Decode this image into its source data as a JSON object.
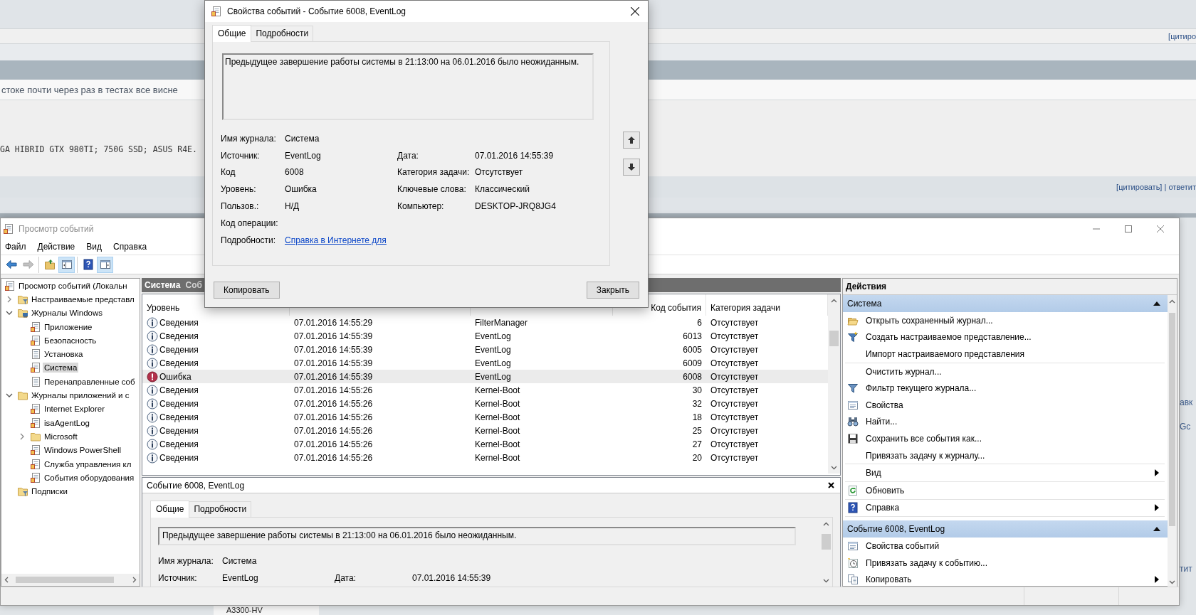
{
  "background_page": {
    "quote_link_top": "[цитиро",
    "post_text": "стоке почти через раз в тестах все висне",
    "signature": "GA HIBRID GTX 980TI; 750G SSD; ASUS R4E.",
    "quote_links": "[цитировать] | ответит",
    "side_fragments": [
      "авк",
      "Gc",
      "тит"
    ],
    "bottom_label": "A3300-HV"
  },
  "event_viewer": {
    "title": "Просмотр событий",
    "menu": [
      "Файл",
      "Действие",
      "Вид",
      "Справка"
    ],
    "toolbar": [
      [
        {
          "kind": "back",
          "pressed": false,
          "disabled": false
        },
        {
          "kind": "forward",
          "pressed": false,
          "disabled": true
        }
      ],
      [
        {
          "kind": "folder-up",
          "pressed": false,
          "disabled": false
        },
        {
          "kind": "panel",
          "pressed": true,
          "disabled": false
        }
      ],
      [
        {
          "kind": "help",
          "pressed": false,
          "disabled": false
        },
        {
          "kind": "panel-right",
          "pressed": true,
          "disabled": false
        }
      ]
    ],
    "tree": [
      {
        "label": "Просмотр событий (Локальн",
        "kind": "log",
        "selected": false,
        "children": [
          {
            "label": "Настраиваемые представл",
            "kind": "folder-filter",
            "selected": false,
            "expanded": false
          },
          {
            "label": "Журналы Windows",
            "kind": "folder-pc",
            "selected": false,
            "expanded": true,
            "children": [
              {
                "label": "Приложение",
                "kind": "log",
                "selected": false
              },
              {
                "label": "Безопасность",
                "kind": "log",
                "selected": false
              },
              {
                "label": "Установка",
                "kind": "doc",
                "selected": false
              },
              {
                "label": "Система",
                "kind": "log",
                "selected": true
              },
              {
                "label": "Перенаправленные соб",
                "kind": "doc",
                "selected": false
              }
            ]
          },
          {
            "label": "Журналы приложений и с",
            "kind": "folder",
            "selected": false,
            "expanded": true,
            "children": [
              {
                "label": "Internet Explorer",
                "kind": "log",
                "selected": false
              },
              {
                "label": "isaAgentLog",
                "kind": "log",
                "selected": false
              },
              {
                "label": "Microsoft",
                "kind": "folder",
                "selected": false,
                "expanded": false
              },
              {
                "label": "Windows PowerShell",
                "kind": "log",
                "selected": false
              },
              {
                "label": "Служба управления кл",
                "kind": "log",
                "selected": false
              },
              {
                "label": "События оборудования",
                "kind": "log",
                "selected": false
              }
            ]
          },
          {
            "label": "Подписки",
            "kind": "folder-filter",
            "selected": false
          }
        ]
      }
    ],
    "events": {
      "header": "Система",
      "header_fragment": "Соб",
      "columns": [
        "Уровень",
        "Код события",
        "Категория задачи"
      ],
      "rows": [
        {
          "kind": "info",
          "level": "Сведения",
          "date": "07.01.2016 14:55:29",
          "source": "FilterManager",
          "code": "6",
          "category": "Отсутствует",
          "selected": false
        },
        {
          "kind": "info",
          "level": "Сведения",
          "date": "07.01.2016 14:55:39",
          "source": "EventLog",
          "code": "6013",
          "category": "Отсутствует",
          "selected": false
        },
        {
          "kind": "info",
          "level": "Сведения",
          "date": "07.01.2016 14:55:39",
          "source": "EventLog",
          "code": "6005",
          "category": "Отсутствует",
          "selected": false
        },
        {
          "kind": "info",
          "level": "Сведения",
          "date": "07.01.2016 14:55:39",
          "source": "EventLog",
          "code": "6009",
          "category": "Отсутствует",
          "selected": false
        },
        {
          "kind": "error",
          "level": "Ошибка",
          "date": "07.01.2016 14:55:39",
          "source": "EventLog",
          "code": "6008",
          "category": "Отсутствует",
          "selected": true
        },
        {
          "kind": "info",
          "level": "Сведения",
          "date": "07.01.2016 14:55:26",
          "source": "Kernel-Boot",
          "code": "30",
          "category": "Отсутствует",
          "selected": false
        },
        {
          "kind": "info",
          "level": "Сведения",
          "date": "07.01.2016 14:55:26",
          "source": "Kernel-Boot",
          "code": "32",
          "category": "Отсутствует",
          "selected": false
        },
        {
          "kind": "info",
          "level": "Сведения",
          "date": "07.01.2016 14:55:26",
          "source": "Kernel-Boot",
          "code": "18",
          "category": "Отсутствует",
          "selected": false
        },
        {
          "kind": "info",
          "level": "Сведения",
          "date": "07.01.2016 14:55:26",
          "source": "Kernel-Boot",
          "code": "25",
          "category": "Отсутствует",
          "selected": false
        },
        {
          "kind": "info",
          "level": "Сведения",
          "date": "07.01.2016 14:55:26",
          "source": "Kernel-Boot",
          "code": "27",
          "category": "Отсутствует",
          "selected": false
        },
        {
          "kind": "info",
          "level": "Сведения",
          "date": "07.01.2016 14:55:26",
          "source": "Kernel-Boot",
          "code": "20",
          "category": "Отсутствует",
          "selected": false
        }
      ]
    },
    "detail": {
      "title": "Событие 6008, EventLog",
      "tabs": [
        {
          "label": "Общие",
          "selected": true
        },
        {
          "label": "Подробности",
          "selected": false
        }
      ],
      "description": "Предыдущее завершение работы системы в 21:13:00 на 06.01.2016 было неожиданным.",
      "fields": [
        {
          "label": "Имя журнала:",
          "value": "Система"
        },
        {
          "label": "Источник:",
          "value": "EventLog"
        }
      ],
      "fields_right": [
        {
          "label": "Дата:",
          "value": "07.01.2016 14:55:39"
        }
      ]
    },
    "actions": {
      "title": "Действия",
      "sections": [
        {
          "title": "Система",
          "expanded": true,
          "groups": [
            [
              {
                "label": "Открыть сохраненный журнал...",
                "kind": "folder-open",
                "submenu": false
              },
              {
                "label": "Создать настраиваемое представление...",
                "kind": "funnel-new",
                "submenu": false
              },
              {
                "label": "Импорт настраиваемого представления",
                "kind": "plain",
                "submenu": false
              }
            ],
            [
              {
                "label": "Очистить журнал...",
                "kind": "plain",
                "submenu": false
              },
              {
                "label": "Фильтр текущего журнала...",
                "kind": "funnel",
                "submenu": false
              },
              {
                "label": "Свойства",
                "kind": "window",
                "submenu": false
              },
              {
                "label": "Найти...",
                "kind": "binoculars",
                "submenu": false
              },
              {
                "label": "Сохранить все события как...",
                "kind": "save",
                "submenu": false
              },
              {
                "label": "Привязать задачу к журналу...",
                "kind": "plain",
                "submenu": false
              }
            ],
            [
              {
                "label": "Вид",
                "kind": "plain",
                "submenu": true
              }
            ],
            [
              {
                "label": "Обновить",
                "kind": "refresh",
                "submenu": false
              }
            ],
            [
              {
                "label": "Справка",
                "kind": "help",
                "submenu": true
              }
            ]
          ]
        },
        {
          "title": "Событие 6008, EventLog",
          "expanded": true,
          "groups": [
            [
              {
                "label": "Свойства событий",
                "kind": "window",
                "submenu": false
              },
              {
                "label": "Привязать задачу к событию...",
                "kind": "clock",
                "submenu": false
              },
              {
                "label": "Копировать",
                "kind": "copy",
                "submenu": true
              }
            ]
          ]
        }
      ]
    }
  },
  "dialog": {
    "title": "Свойства событий - Событие 6008, EventLog",
    "tabs": [
      {
        "label": "Общие",
        "selected": true
      },
      {
        "label": "Подробности",
        "selected": false
      }
    ],
    "description": "Предыдущее завершение работы системы в 21:13:00 на 06.01.2016 было неожиданным.",
    "fields": [
      {
        "label": "Имя журнала:",
        "value": "Система"
      },
      {
        "label": "Источник:",
        "value": "EventLog"
      },
      {
        "label": "Код",
        "value": "6008"
      },
      {
        "label": "Уровень:",
        "value": "Ошибка"
      },
      {
        "label": "Пользов.:",
        "value": "Н/Д"
      },
      {
        "label": "Код операции:"
      },
      {
        "label": "Подробности:",
        "link": "Справка в Интернете для"
      }
    ],
    "fields_right": [
      {
        "label": "Дата:",
        "value": "07.01.2016 14:55:39"
      },
      {
        "label": "Категория задачи:",
        "value": "Отсутствует"
      },
      {
        "label": "Ключевые слова:",
        "value": "Классический"
      },
      {
        "label": "Компьютер:",
        "value": "DESKTOP-JRQ8JG4"
      }
    ],
    "buttons": [
      "Копировать",
      "Закрыть"
    ]
  }
}
